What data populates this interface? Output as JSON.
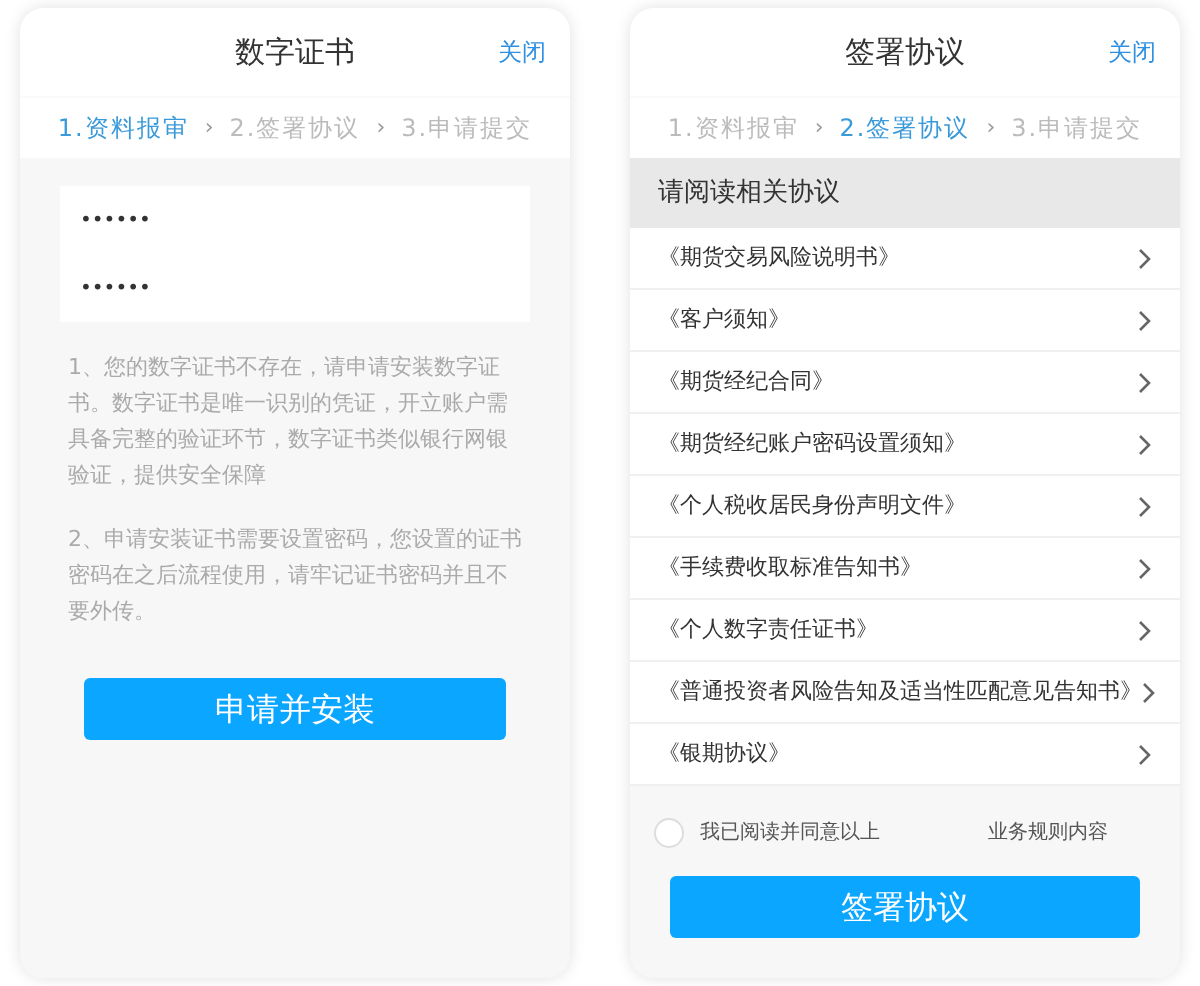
{
  "panels": [
    {
      "kind": "certificate",
      "title": "数字证书",
      "close": "关闭",
      "steps": [
        {
          "label": "1.资料报审",
          "selected": true
        },
        {
          "label": "2.签署协议",
          "selected": false
        },
        {
          "label": "3.申请提交",
          "selected": false
        }
      ],
      "step_separator": "›",
      "password_fields": [
        {
          "value": "••••••"
        },
        {
          "value": "••••••"
        }
      ],
      "notes": [
        "1、您的数字证书不存在，请申请安装数字证书。数字证书是唯一识别的凭证，开立账户需具备完整的验证环节，数字证书类似银行网银验证，提供安全保障",
        "2、申请安装证书需要设置密码，您设置的证书密码在之后流程使用，请牢记证书密码并且不要外传。"
      ],
      "button": "申请并安装"
    },
    {
      "kind": "agreement",
      "title": "签署协议",
      "close": "关闭",
      "steps": [
        {
          "label": "1.资料报审",
          "selected": false
        },
        {
          "label": "2.签署协议",
          "selected": true
        },
        {
          "label": "3.申请提交",
          "selected": false
        }
      ],
      "step_separator": "›",
      "section_header": "请阅读相关协议",
      "agreements": [
        "《期货交易风险说明书》",
        "《客户须知》",
        "《期货经纪合同》",
        "《期货经纪账户密码设置须知》",
        "《个人税收居民身份声明文件》",
        "《手续费收取标准告知书》",
        "《个人数字责任证书》",
        "《普通投资者风险告知及适当性匹配意见告知书》",
        "《银期协议》"
      ],
      "consent": {
        "checked": false,
        "text_before": "我已阅读并同意以上",
        "text_after": "业务规则内容"
      },
      "button": "签署协议"
    }
  ]
}
